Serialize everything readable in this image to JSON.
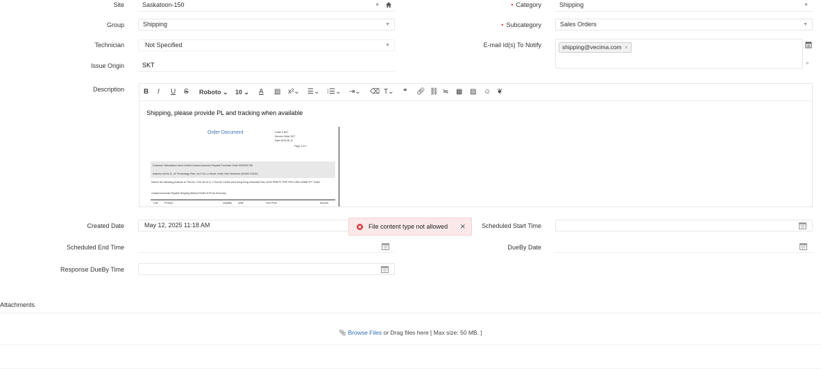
{
  "form": {
    "site": {
      "label": "Site",
      "value": "Saskatoon-150"
    },
    "group": {
      "label": "Group",
      "value": "Shipping"
    },
    "technician": {
      "label": "Technician",
      "value": "Not Specified"
    },
    "issue_origin": {
      "label": "Issue Origin",
      "value": "SKT"
    },
    "category": {
      "label": "Category",
      "value": "Shipping"
    },
    "subcategory": {
      "label": "Subcategory",
      "value": "Sales Orders"
    },
    "email_notify": {
      "label": "E-mail Id(s) To Notify",
      "chip": "shipping@vecima.com"
    },
    "description": {
      "label": "Description",
      "text": "Shipping, please provide PL and tracking when available",
      "toolbar": {
        "font": "Roboto",
        "size": "10"
      }
    },
    "created_date": {
      "label": "Created Date",
      "value": "May 12, 2025 11:18 AM"
    },
    "scheduled_start": {
      "label": "Scheduled Start Time",
      "value": ""
    },
    "scheduled_end": {
      "label": "Scheduled End Time",
      "value": ""
    },
    "dueby_date": {
      "label": "DueBy Date",
      "value": ""
    },
    "response_dueby": {
      "label": "Response DueBy Time",
      "value": ""
    }
  },
  "embedded_doc": {
    "title": "Order Document",
    "meta": [
      "Order #   SKT",
      "Service Order   SKT",
      "Date   2025-05-12",
      "Page 1 of 1"
    ],
    "customer_row": "Customer  Vidsolutions Vecs Limited      Contact  Accounts Payable                    Purchase Order  0000091758",
    "address_row": "Address   Unit 8-11, XX Technology Park, No 9 Gu Lu Street, Hefei, New Territories (HONG KONG)",
    "deliver_row": "Deliver the following products to:   Plot No. CH3 18-19 11 7 Hua He Centre area Hong Kong Industrial Park, WIJS PRB-PC PRE PRO-C5B-100MB VPT 9 AMI",
    "contact_row": "Contact    Accounts Payable          Shipping Method   FedEx EXP Air Economy",
    "table_header": [
      "Line",
      "Product",
      "Quantity",
      "Units",
      "Your Price",
      "Amount"
    ]
  },
  "toast": {
    "message": "File content type not allowed"
  },
  "attachments": {
    "title": "Attachments",
    "browse": "Browse Files",
    "hint": " or Drag files here [ Max size: 50 MB. ]"
  }
}
